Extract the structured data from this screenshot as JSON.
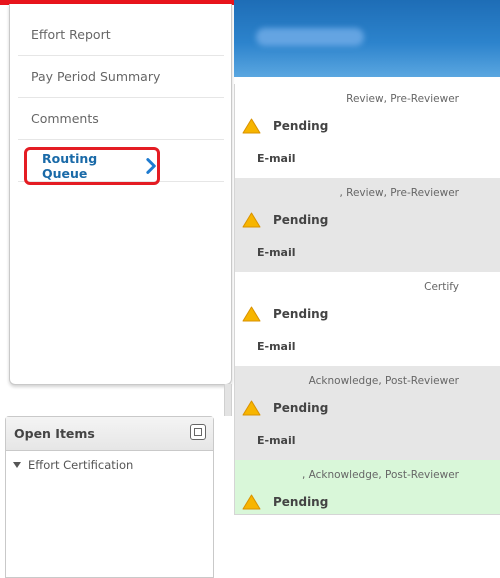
{
  "nav": {
    "items": [
      {
        "label": "Effort Report"
      },
      {
        "label": "Pay Period Summary"
      },
      {
        "label": "Comments"
      }
    ],
    "active_label": "Routing Queue"
  },
  "open_items": {
    "title": "Open Items",
    "tree_item": "Effort Certification"
  },
  "queue": {
    "rows": [
      {
        "role": "Review, Pre-Reviewer",
        "status": "Pending",
        "email": "E-mail",
        "bg": "#ffffff"
      },
      {
        "role": ", Review, Pre-Reviewer",
        "status": "Pending",
        "email": "E-mail",
        "bg": "#e6e6e6"
      },
      {
        "role": "Certify",
        "status": "Pending",
        "email": "E-mail",
        "bg": "#ffffff"
      },
      {
        "role": "Acknowledge, Post-Reviewer",
        "status": "Pending",
        "email": "E-mail",
        "bg": "#e6e6e6"
      },
      {
        "role": ", Acknowledge, Post-Reviewer",
        "status": "Pending",
        "email": "",
        "bg": "#d9f7d9"
      }
    ]
  },
  "colors": {
    "accent_red": "#e41c23",
    "link_blue": "#1a6aa8",
    "warning": "#f7b500"
  },
  "icons": {
    "routing_arrow": "chevron-right-icon",
    "status": "warning-triangle-icon",
    "open_items_toggle": "maximize-icon",
    "tree": "caret-down-icon"
  }
}
